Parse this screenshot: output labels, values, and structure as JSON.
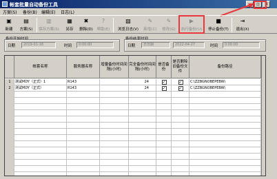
{
  "window": {
    "title": "帐套批量自动备份工具",
    "minimize": "_",
    "maximize": "▫",
    "close": "✕"
  },
  "menu": [
    "方案(S)",
    "备份(B)",
    "编辑(E)",
    "日志(L)"
  ],
  "toolbar": [
    {
      "label": "新建",
      "icon": "new-icon",
      "glyph": "▣",
      "disabled": false
    },
    {
      "label": "方案(S)",
      "icon": "scheme-icon",
      "glyph": "▤",
      "disabled": false
    },
    {
      "label": "保存方案(S)",
      "icon": "save-scheme-icon",
      "glyph": "▥",
      "disabled": true
    },
    {
      "label": "另存",
      "icon": "save-as-icon",
      "glyph": "▦",
      "disabled": false
    },
    {
      "label": "删除(D)",
      "icon": "delete-icon",
      "glyph": "✖",
      "disabled": false
    },
    {
      "label": "帮助(E)",
      "icon": "help-icon",
      "glyph": "?",
      "disabled": true
    },
    {
      "label": "浏览日志(V)",
      "icon": "view-log-icon",
      "glyph": "▧",
      "disabled": false
    },
    {
      "label": "新增(C)",
      "icon": "add-icon",
      "glyph": "✎",
      "disabled": true
    },
    {
      "label": "修改(G)",
      "icon": "edit-icon",
      "glyph": "✎",
      "disabled": true
    },
    {
      "label": "执行备份(U)",
      "icon": "run-backup-icon",
      "glyph": "▶",
      "disabled": true
    },
    {
      "label": "停止备份(T)",
      "icon": "stop-backup-icon",
      "glyph": "■",
      "disabled": false
    },
    {
      "label": "退出(X)",
      "icon": "exit-icon",
      "glyph": "⇥",
      "disabled": false
    }
  ],
  "start_group": {
    "title": "备份开始时间",
    "date_label": "日期",
    "date_value": "2019-01-16",
    "time_label": "时间",
    "time_value": "0:00:00"
  },
  "end_group": {
    "title": "备份结束时间",
    "date_label": "日期",
    "date_check": "日日期",
    "date_value": "2022-04-27",
    "time_label": "时间",
    "time_value": "0:00:00"
  },
  "columns": [
    "帐套名称",
    "服务器名称",
    "增量备份时间间隔(小时)",
    "完全备份时间间隔(小时)",
    "是否备份",
    "是否删除旧备份文件",
    "备份路径"
  ],
  "rows": [
    {
      "num": "1",
      "name": "测试MDY（正式）1",
      "server": "R143",
      "inc": "",
      "full": "24",
      "backup": "✓",
      "del": "✓",
      "path": "C:\\ZZBGNOBEPEBW\\"
    },
    {
      "num": "2",
      "name": "测试MDY（正式）",
      "server": "R143",
      "inc": "",
      "full": "24",
      "backup": "✓",
      "del": "✓",
      "path": "C:\\ZZBGNOBEPEBW\\"
    }
  ],
  "highlight_color": "#e8383d"
}
